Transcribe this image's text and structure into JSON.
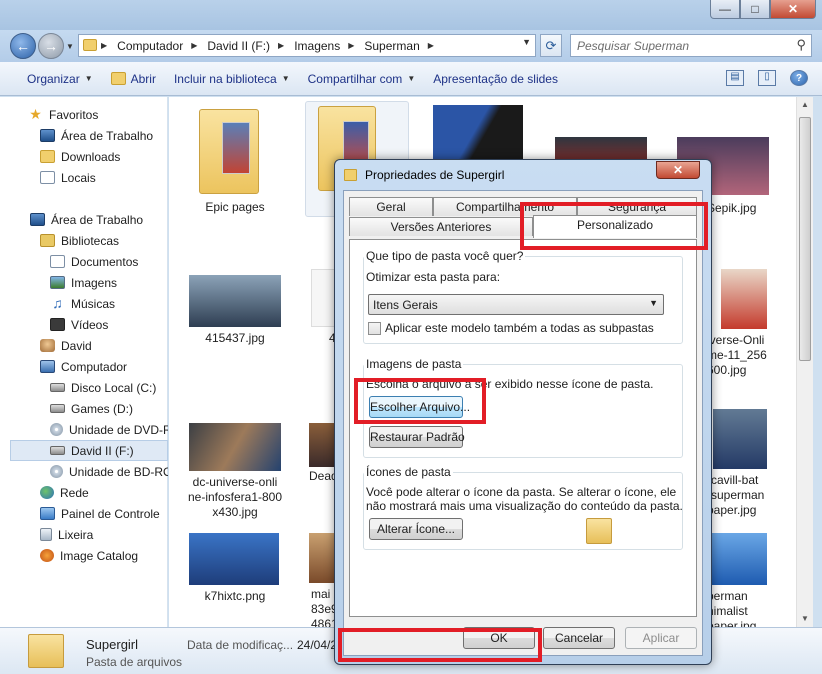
{
  "window": {
    "controls": {
      "minimize": "—",
      "maximize": "□",
      "close": "✕"
    }
  },
  "navigation": {
    "back_icon": "back-arrow-icon",
    "forward_icon": "forward-arrow-icon",
    "breadcrumbs": [
      "Computador",
      "David II (F:)",
      "Imagens",
      "Superman"
    ],
    "search_placeholder": "Pesquisar Superman"
  },
  "toolbar": {
    "items": [
      "Organizar",
      "Abrir",
      "Incluir na biblioteca",
      "Compartilhar com",
      "Apresentação de slides"
    ]
  },
  "sidebar": {
    "items": [
      {
        "label": "Favoritos",
        "icon": "star-icon"
      },
      {
        "label": "Área de Trabalho",
        "icon": "desktop-icon"
      },
      {
        "label": "Downloads",
        "icon": "downloads-icon"
      },
      {
        "label": "Locais",
        "icon": "places-icon"
      },
      {
        "label": "Área de Trabalho",
        "icon": "desktop-icon"
      },
      {
        "label": "Bibliotecas",
        "icon": "libraries-icon"
      },
      {
        "label": "Documentos",
        "icon": "documents-icon"
      },
      {
        "label": "Imagens",
        "icon": "pictures-icon"
      },
      {
        "label": "Músicas",
        "icon": "music-icon"
      },
      {
        "label": "Vídeos",
        "icon": "videos-icon"
      },
      {
        "label": "David",
        "icon": "user-icon"
      },
      {
        "label": "Computador",
        "icon": "computer-icon"
      },
      {
        "label": "Disco Local (C:)",
        "icon": "disk-icon"
      },
      {
        "label": "Games (D:)",
        "icon": "disk-icon"
      },
      {
        "label": "Unidade de DVD-R",
        "icon": "dvd-icon"
      },
      {
        "label": "David II (F:)",
        "icon": "disk-icon"
      },
      {
        "label": "Unidade de BD-RO",
        "icon": "bd-icon"
      },
      {
        "label": "Rede",
        "icon": "network-icon"
      },
      {
        "label": "Painel de Controle",
        "icon": "control-panel-icon"
      },
      {
        "label": "Lixeira",
        "icon": "recycle-bin-icon"
      },
      {
        "label": "Image Catalog",
        "icon": "catalog-icon"
      }
    ]
  },
  "files": {
    "epic_pages": "Epic pages",
    "f415437": "415437.jpg",
    "f415437_neighbor": "4",
    "sepik": "-Sepik.jpg",
    "universe_online": "iverse-Onli\nme-11_256\n600.jpg",
    "dc_universe": "dc-universe-onli\nne-infosfera1-800\nx430.jpg",
    "dead": "Dead",
    "cavill": "-cavill-bat\n-superman\npaper.jpg",
    "k7hixtc": "k7hixtc.png",
    "main": "mai\n83e9\n4861",
    "minimalist": "perman\nnimalist\npaper.jpg"
  },
  "details": {
    "name": "Supergirl",
    "type": "Pasta de arquivos",
    "label": "Data de modificaç...",
    "value": "24/04/2"
  },
  "dialog": {
    "title": "Propriedades de Supergirl",
    "close": "✕",
    "tabs": {
      "geral": "Geral",
      "compartilhamento": "Compartilhamento",
      "seguranca": "Segurança",
      "versoes": "Versões Anteriores",
      "personalizado": "Personalizado"
    },
    "folder_type": {
      "legend": "Que tipo de pasta você quer?",
      "optimize_label": "Otimizar esta pasta para:",
      "selected": "Itens Gerais",
      "apply_subfolders": "Aplicar este modelo também a todas as subpastas"
    },
    "folder_pictures": {
      "legend": "Imagens de pasta",
      "description": "Escolha o arquivo a ser exibido nesse ícone de pasta.",
      "choose_file": "Escolher Arquivo...",
      "restore_default": "Restaurar Padrão"
    },
    "folder_icons": {
      "legend": "Ícones de pasta",
      "description_line1": "Você pode alterar o ícone da pasta. Se alterar o ícone, ele",
      "description_line2": "não mostrará mais uma visualização do conteúdo da pasta.",
      "change_icon": "Alterar Ícone..."
    },
    "buttons": {
      "ok": "OK",
      "cancel": "Cancelar",
      "apply": "Aplicar"
    }
  },
  "colors": {
    "highlight_box": "#e21d26",
    "explorer_chrome": "#b9d1ea"
  }
}
